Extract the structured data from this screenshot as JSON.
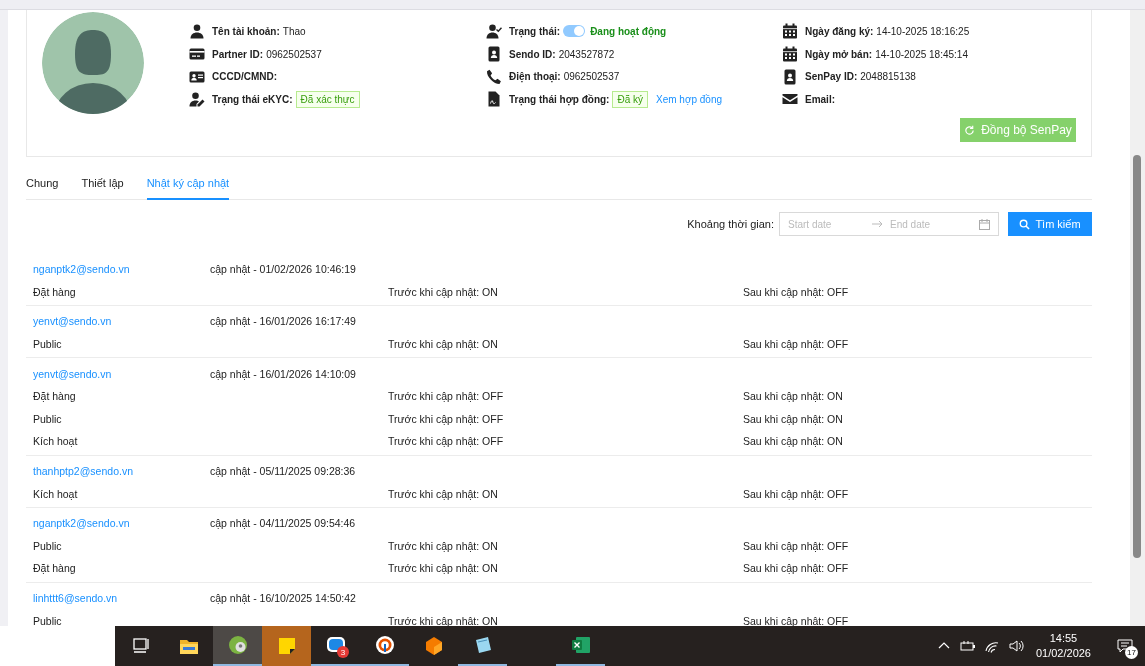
{
  "profile": {
    "columns": [
      [
        {
          "kind": "text",
          "label": "Tên tài khoản:",
          "value": "Thao"
        },
        {
          "kind": "text",
          "label": "Partner ID:",
          "value": "0962502537"
        },
        {
          "kind": "text",
          "label": "CCCD/CMND:"
        },
        {
          "kind": "tag",
          "label": "Trạng thái eKYC:",
          "tag": "Đã xác thực"
        }
      ],
      [
        {
          "kind": "toggle",
          "label": "Trạng thái:",
          "on": true,
          "value": "Đang hoạt động"
        },
        {
          "kind": "text",
          "label": "Sendo ID:",
          "value": "2043527872"
        },
        {
          "kind": "text",
          "label": "Điện thoại:",
          "value": "0962502537"
        },
        {
          "kind": "tag",
          "label": "Trạng thái hợp đồng:",
          "tag": "Đã ký",
          "link": "Xem hợp đồng"
        }
      ],
      [
        {
          "kind": "text",
          "label": "Ngày đăng ký:",
          "value": "14-10-2025 18:16:25"
        },
        {
          "kind": "text",
          "label": "Ngày mở bán:",
          "value": "14-10-2025 18:45:14"
        },
        {
          "kind": "text",
          "label": "SenPay ID:",
          "value": "2048815138"
        },
        {
          "kind": "text",
          "label": "Email:"
        }
      ]
    ],
    "sync_button": "Đồng bộ SenPay"
  },
  "tabs": [
    {
      "label": "Chung",
      "selected": false
    },
    {
      "label": "Thiết lập",
      "selected": false
    },
    {
      "label": "Nhật ký cập nhật",
      "selected": true
    }
  ],
  "filter": {
    "label": "Khoảng thời gian:",
    "start_placeholder": "Start date",
    "end_placeholder": "End date",
    "search_button": "Tìm kiếm"
  },
  "log": [
    {
      "user": "nganptk2@sendo.vn",
      "time": "cập nhật - 01/02/2026 10:46:19",
      "changes": [
        {
          "field": "Đặt hàng",
          "before": "Trước khi cập nhật: ON",
          "after": "Sau khi cập nhật: OFF"
        }
      ]
    },
    {
      "user": "yenvt@sendo.vn",
      "time": "cập nhật - 16/01/2026 16:17:49",
      "changes": [
        {
          "field": "Public",
          "before": "Trước khi cập nhật: ON",
          "after": "Sau khi cập nhật: OFF"
        }
      ]
    },
    {
      "user": "yenvt@sendo.vn",
      "time": "cập nhật - 16/01/2026 14:10:09",
      "changes": [
        {
          "field": "Đặt hàng",
          "before": "Trước khi cập nhật: OFF",
          "after": "Sau khi cập nhật: ON"
        },
        {
          "field": "Public",
          "before": "Trước khi cập nhật: OFF",
          "after": "Sau khi cập nhật: ON"
        },
        {
          "field": "Kích hoạt",
          "before": "Trước khi cập nhật: OFF",
          "after": "Sau khi cập nhật: ON"
        }
      ]
    },
    {
      "user": "thanhptp2@sendo.vn",
      "time": "cập nhật - 05/11/2025 09:28:36",
      "changes": [
        {
          "field": "Kích hoạt",
          "before": "Trước khi cập nhật: ON",
          "after": "Sau khi cập nhật: OFF"
        }
      ]
    },
    {
      "user": "nganptk2@sendo.vn",
      "time": "cập nhật - 04/11/2025 09:54:46",
      "changes": [
        {
          "field": "Public",
          "before": "Trước khi cập nhật: ON",
          "after": "Sau khi cập nhật: OFF"
        },
        {
          "field": "Đặt hàng",
          "before": "Trước khi cập nhật: ON",
          "after": "Sau khi cập nhật: OFF"
        }
      ]
    },
    {
      "user": "linhttt6@sendo.vn",
      "time": "cập nhật - 16/10/2025 14:50:42",
      "changes": [
        {
          "field": "Public",
          "before": "Trước khi cập nhật: ON",
          "after": "Sau khi cập nhật: OFF"
        }
      ]
    }
  ],
  "taskbar": {
    "items": [
      {
        "kind": "taskview",
        "selected": false,
        "running": false
      },
      {
        "kind": "folder",
        "selected": false,
        "running": false
      },
      {
        "kind": "greenapp",
        "selected": true,
        "running": true
      },
      {
        "kind": "note",
        "selected": false,
        "running": false,
        "attention": true
      },
      {
        "kind": "chat",
        "selected": false,
        "running": true,
        "badge": "3"
      },
      {
        "kind": "ring",
        "selected": false,
        "running": true
      },
      {
        "kind": "cube",
        "selected": false,
        "running": false
      },
      {
        "kind": "notepad",
        "selected": false,
        "running": true
      },
      {
        "kind": "sheet",
        "selected": false,
        "running": true
      }
    ],
    "time": "14:55",
    "date": "01/02/2026",
    "notifications": "17"
  }
}
